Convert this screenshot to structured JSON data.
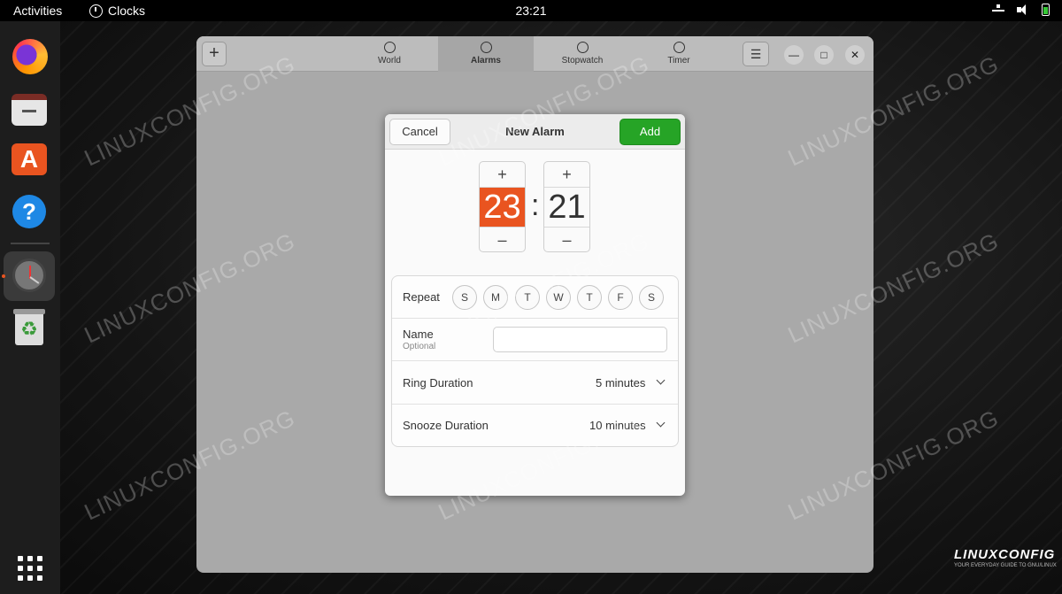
{
  "topbar": {
    "activities": "Activities",
    "app_name": "Clocks",
    "time": "23:21"
  },
  "window": {
    "tabs": [
      {
        "label": "World",
        "icon": "globe-icon"
      },
      {
        "label": "Alarms",
        "icon": "alarm-icon"
      },
      {
        "label": "Stopwatch",
        "icon": "stopwatch-icon"
      },
      {
        "label": "Timer",
        "icon": "timer-icon"
      }
    ],
    "active_tab": "Alarms",
    "add_glyph": "+",
    "menu_glyph": "☰",
    "minimize_glyph": "—",
    "maximize_glyph": "□",
    "close_glyph": "✕"
  },
  "dialog": {
    "title": "New Alarm",
    "cancel_label": "Cancel",
    "add_label": "Add",
    "hour": "23",
    "minute": "21",
    "colon": ":",
    "plus_glyph": "+",
    "minus_glyph": "–",
    "repeat_label": "Repeat",
    "days": [
      "S",
      "M",
      "T",
      "W",
      "T",
      "F",
      "S"
    ],
    "name_label": "Name",
    "name_hint": "Optional",
    "name_value": "",
    "ring_label": "Ring Duration",
    "ring_value": "5 minutes",
    "snooze_label": "Snooze Duration",
    "snooze_value": "10 minutes"
  },
  "watermark": {
    "text": "LINUXCONFIG.ORG",
    "logo": "LINUXCONFIG",
    "tagline": "YOUR EVERYDAY GUIDE TO GNU/LINUX"
  },
  "colors": {
    "accent": "#e95420",
    "add_button": "#26a426"
  }
}
